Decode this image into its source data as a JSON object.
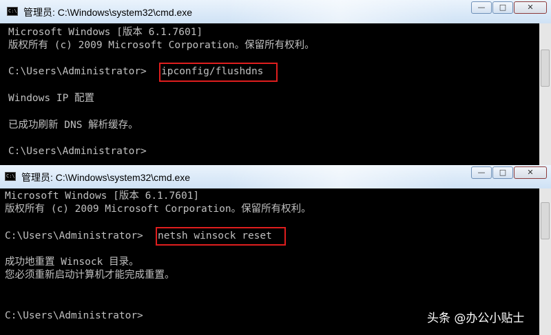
{
  "windows": [
    {
      "title": "管理员: C:\\Windows\\system32\\cmd.exe",
      "icon_text": "C:\\",
      "controls": {
        "minimize": "—",
        "maximize": "□",
        "close": "✕"
      },
      "lines": [
        "Microsoft Windows [版本 6.1.7601]",
        "版权所有 (c) 2009 Microsoft Corporation。保留所有权利。",
        "C:\\Users\\Administrator>",
        "Windows IP 配置",
        "已成功刷新 DNS 解析缓存。",
        "C:\\Users\\Administrator>"
      ],
      "command": "ipconfig/flushdns"
    },
    {
      "title": "管理员: C:\\Windows\\system32\\cmd.exe",
      "icon_text": "C:\\",
      "controls": {
        "minimize": "—",
        "maximize": "□",
        "close": "✕"
      },
      "lines": [
        "Microsoft Windows [版本 6.1.7601]",
        "版权所有 (c) 2009 Microsoft Corporation。保留所有权利。",
        "C:\\Users\\Administrator>",
        "成功地重置 Winsock 目录。",
        "您必须重新启动计算机才能完成重置。",
        "C:\\Users\\Administrator>"
      ],
      "command": "netsh winsock reset"
    }
  ],
  "watermark": "头条 @办公小贴士",
  "colors": {
    "console_bg": "#000000",
    "console_text": "#c0c0c0",
    "highlight_border": "#e01e1e"
  }
}
